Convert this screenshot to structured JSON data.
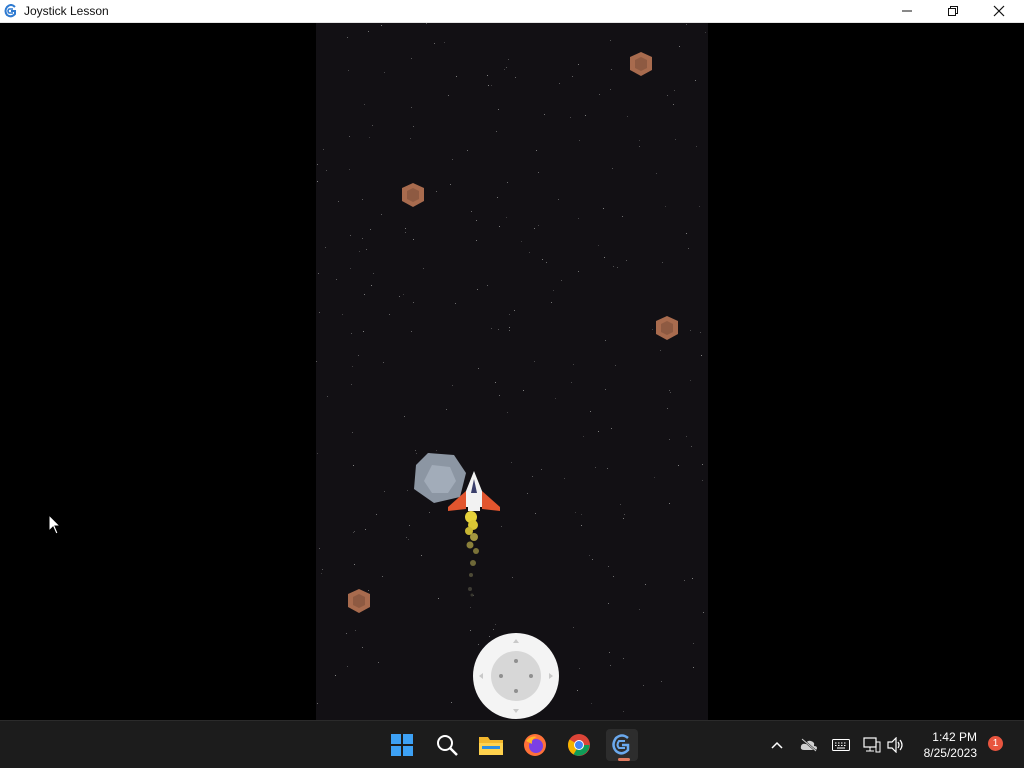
{
  "window": {
    "title": "Joystick Lesson",
    "controls": [
      "minimize-icon",
      "restore-icon",
      "close-icon"
    ]
  },
  "game": {
    "background_color": "#121014",
    "objects": [
      "small-asteroid",
      "small-asteroid",
      "small-asteroid",
      "small-asteroid",
      "large-asteroid",
      "player-spaceship",
      "exhaust-trail"
    ],
    "joystick": {
      "center_icon": "dpad-dots-icon",
      "arrows": [
        "up",
        "down",
        "left",
        "right"
      ]
    }
  },
  "taskbar": {
    "apps": [
      "windows-start-icon",
      "search-icon",
      "file-explorer-icon",
      "firefox-icon",
      "chrome-icon",
      "gdevelop-icon"
    ],
    "tray_icons": [
      "chevron-up-icon",
      "onedrive-offline-icon",
      "keyboard-icon",
      "network-icon",
      "volume-icon"
    ],
    "clock": {
      "time": "1:42 PM",
      "date": "8/25/2023"
    },
    "notification_count": "1"
  },
  "colors": {
    "accent": "#e07a5f",
    "asteroid": "#a86b4e",
    "ship_body": "#f2f2f2",
    "ship_wing": "#e2552e"
  }
}
